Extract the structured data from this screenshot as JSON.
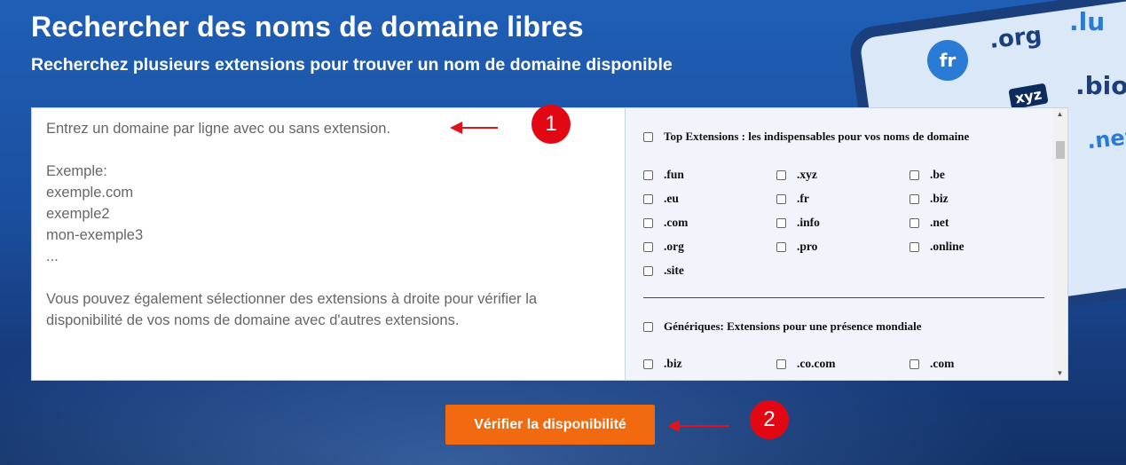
{
  "hero": {
    "title": "Rechercher des noms de domaine libres",
    "subtitle": "Recherchez plusieurs extensions pour trouver un nom de domaine disponible"
  },
  "search": {
    "placeholder": "Entrez un domaine par ligne avec ou sans extension.\n\nExemple:\nexemple.com\nexemple2\nmon-exemple3\n...\n\nVous pouvez également sélectionner des extensions à droite pour vérifier la disponibilité de vos noms de domaine avec d'autres extensions.",
    "value": ""
  },
  "extensions": {
    "top_group": {
      "label": "Top Extensions : les indispensables pour vos noms de domaine",
      "items": [
        ".fun",
        ".xyz",
        ".be",
        ".eu",
        ".fr",
        ".biz",
        ".com",
        ".info",
        ".net",
        ".org",
        ".pro",
        ".online",
        ".site"
      ]
    },
    "generic_group": {
      "label": "Génériques: Extensions pour une présence mondiale",
      "items": [
        ".biz",
        ".co.com",
        ".com"
      ]
    }
  },
  "actions": {
    "check_label": "Vérifier la disponibilité"
  },
  "annotations": {
    "marker_1": "1",
    "marker_2": "2",
    "color": "#e30613"
  },
  "decor": {
    "tags": [
      ".org",
      ".lu",
      ".bio",
      "xyz",
      ".new",
      "fr"
    ]
  },
  "colors": {
    "button": "#f26a10",
    "panel_bg": "#f1f4fb",
    "background": "#1b4f9f"
  }
}
